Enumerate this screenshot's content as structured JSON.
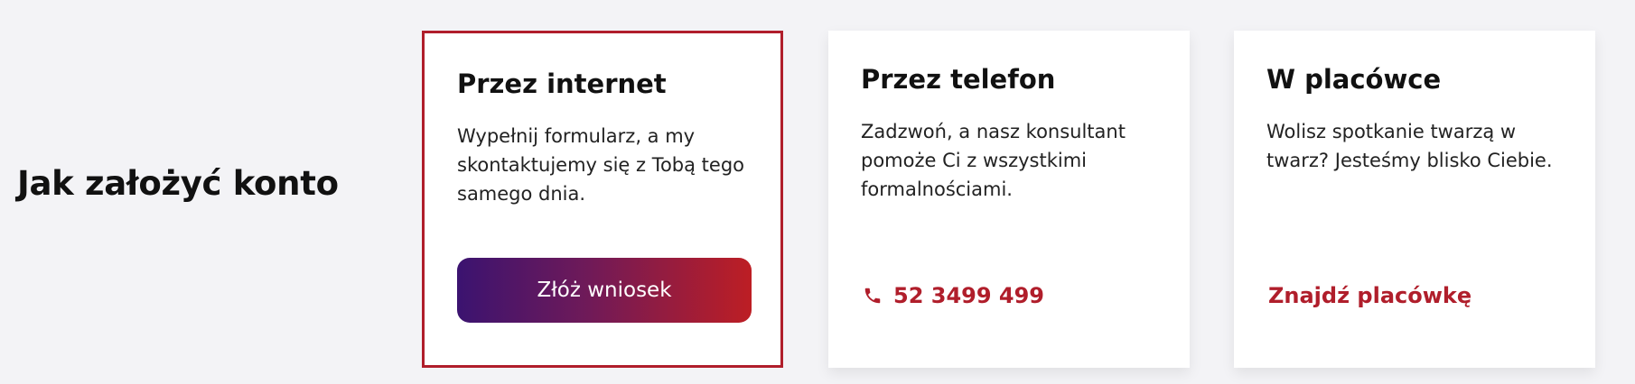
{
  "section": {
    "title": "Jak założyć konto"
  },
  "cards": [
    {
      "title": "Przez internet",
      "description": "Wypełnij formularz, a my skontaktujemy się z Tobą tego samego dnia.",
      "cta_label": "Złóż wniosek"
    },
    {
      "title": "Przez telefon",
      "description": "Zadzwoń, a nasz konsultant pomoże Ci z wszystkimi formalnościami.",
      "phone_icon": "phone-icon",
      "phone_number": "52 3499 499"
    },
    {
      "title": "W placówce",
      "description": "Wolisz spotkanie twarzą w twarz? Jesteśmy blisko Ciebie.",
      "link_label": "Znajdź placówkę"
    }
  ],
  "colors": {
    "accent": "#b01e2b",
    "gradient_start": "#3b1370",
    "gradient_end": "#bd1e24",
    "background": "#f3f3f6"
  }
}
